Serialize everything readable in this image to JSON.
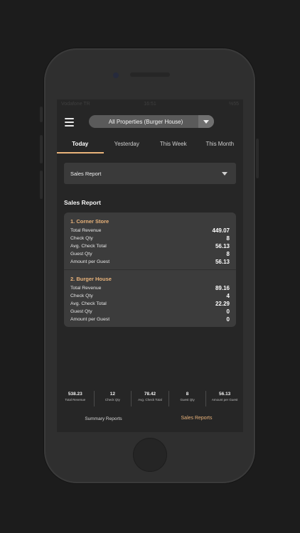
{
  "status_bar": {
    "carrier": "Vodafone TR",
    "time": "16:51",
    "battery": "%55"
  },
  "header": {
    "property_select": "All Properties (Burger House)"
  },
  "tabs": [
    {
      "label": "Today",
      "active": true
    },
    {
      "label": "Yesterday",
      "active": false
    },
    {
      "label": "This Week",
      "active": false
    },
    {
      "label": "This Month",
      "active": false
    }
  ],
  "report_select": {
    "value": "Sales Report"
  },
  "section_title": "Sales Report",
  "stores": [
    {
      "name": "1. Corner Store",
      "rows": [
        {
          "label": "Total Revenue",
          "value": "449.07"
        },
        {
          "label": "Check Qty",
          "value": "8"
        },
        {
          "label": "Avg. Check Total",
          "value": "56.13"
        },
        {
          "label": "Guest Qty",
          "value": "8"
        },
        {
          "label": "Amount per Guest",
          "value": "56.13"
        }
      ]
    },
    {
      "name": "2. Burger House",
      "rows": [
        {
          "label": "Total Revenue",
          "value": "89.16"
        },
        {
          "label": "Check Qty",
          "value": "4"
        },
        {
          "label": "Avg. Check Total",
          "value": "22.29"
        },
        {
          "label": "Guest Qty",
          "value": "0"
        },
        {
          "label": "Amount per Guest",
          "value": "0"
        }
      ]
    }
  ],
  "totals": [
    {
      "value": "538.23",
      "label": "Total Revenue"
    },
    {
      "value": "12",
      "label": "Check Qty"
    },
    {
      "value": "78.42",
      "label": "Avg. Check Total"
    },
    {
      "value": "8",
      "label": "Guest Qty"
    },
    {
      "value": "56.13",
      "label": "Amount per Guest"
    }
  ],
  "bottom_tabs": [
    {
      "label": "Summary Reports",
      "active": false
    },
    {
      "label": "Sales Reports",
      "active": true
    }
  ],
  "colors": {
    "accent": "#e9b37a",
    "background": "#262626",
    "card": "#3c3c3c"
  }
}
